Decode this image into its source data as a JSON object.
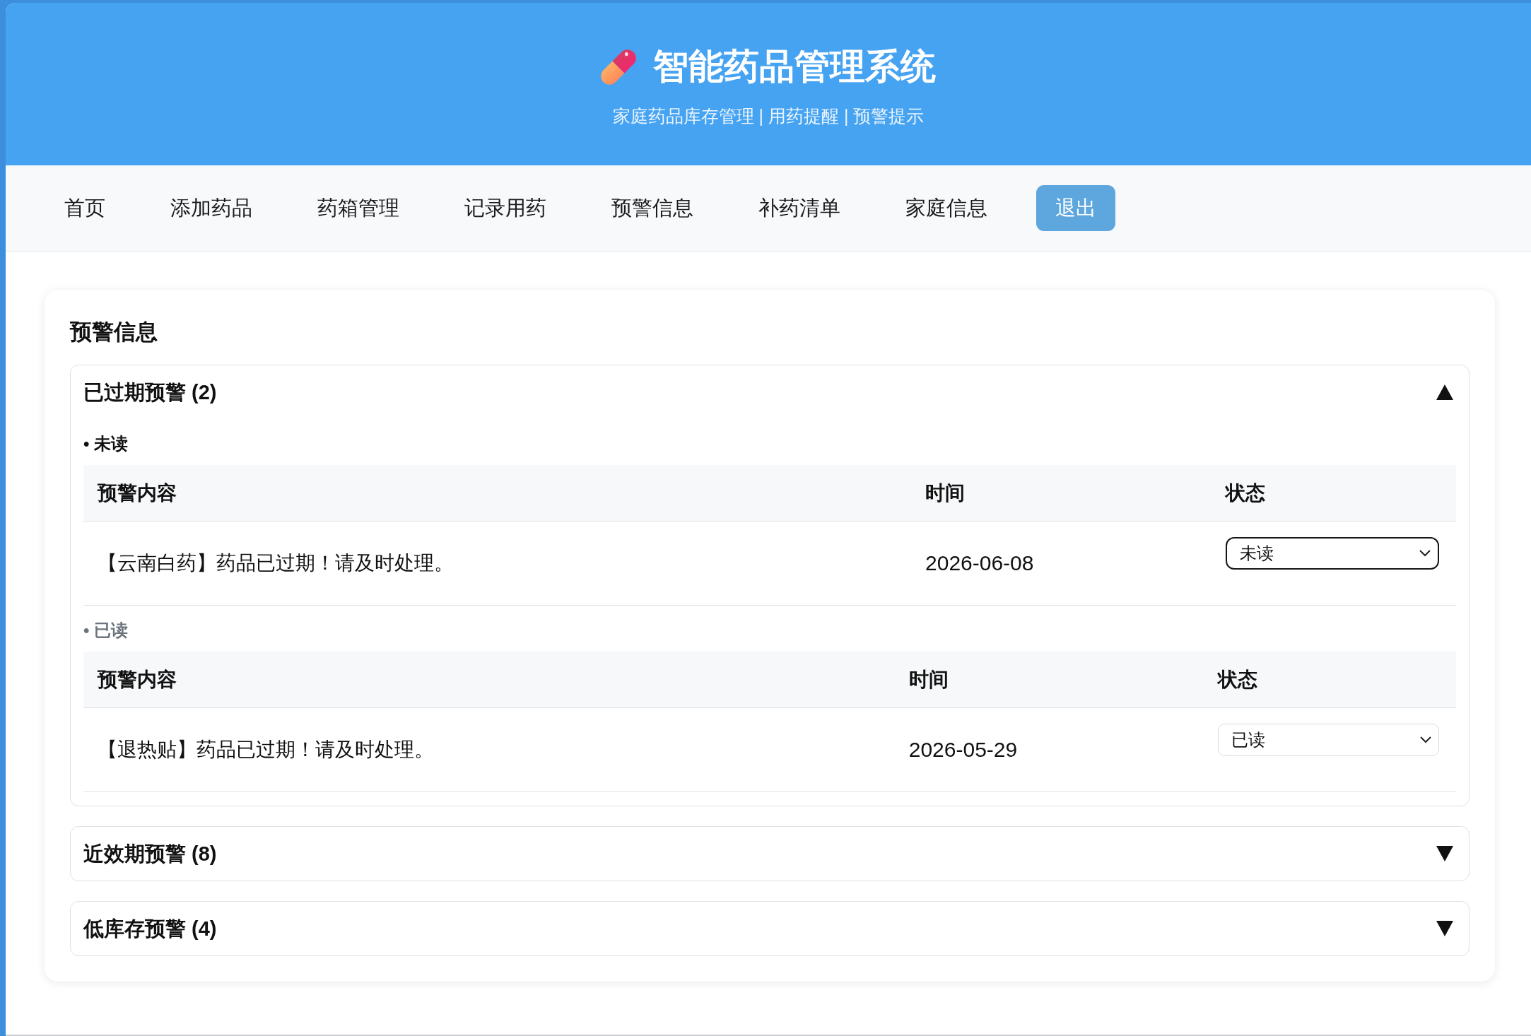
{
  "header": {
    "title": "智能药品管理系统",
    "subtitle": "家庭药品库存管理 | 用药提醒 | 预警提示"
  },
  "nav": {
    "items": [
      {
        "label": "首页",
        "kind": "link"
      },
      {
        "label": "添加药品",
        "kind": "link"
      },
      {
        "label": "药箱管理",
        "kind": "link"
      },
      {
        "label": "记录用药",
        "kind": "link"
      },
      {
        "label": "预警信息",
        "kind": "link"
      },
      {
        "label": "补药清单",
        "kind": "link"
      },
      {
        "label": "家庭信息",
        "kind": "link"
      },
      {
        "label": "退出",
        "kind": "button"
      }
    ]
  },
  "panel": {
    "title": "预警信息",
    "sections": [
      {
        "title": "已过期预警 (2)",
        "expanded": true,
        "groups": [
          {
            "label": "• 未读",
            "read": false,
            "table": {
              "columns": [
                "预警内容",
                "时间",
                "状态"
              ],
              "rows": [
                {
                  "content": "【云南白药】药品已过期！请及时处理。",
                  "time": "2026-06-08",
                  "status": {
                    "value": "未读",
                    "focused": true
                  }
                }
              ]
            }
          },
          {
            "label": "• 已读",
            "read": true,
            "table": {
              "columns": [
                "预警内容",
                "时间",
                "状态"
              ],
              "rows": [
                {
                  "content": "【退热贴】药品已过期！请及时处理。",
                  "time": "2026-05-29",
                  "status": {
                    "value": "已读",
                    "focused": false
                  }
                }
              ]
            }
          }
        ]
      },
      {
        "title": "近效期预警 (8)",
        "expanded": false
      },
      {
        "title": "低库存预警 (4)",
        "expanded": false
      }
    ]
  }
}
